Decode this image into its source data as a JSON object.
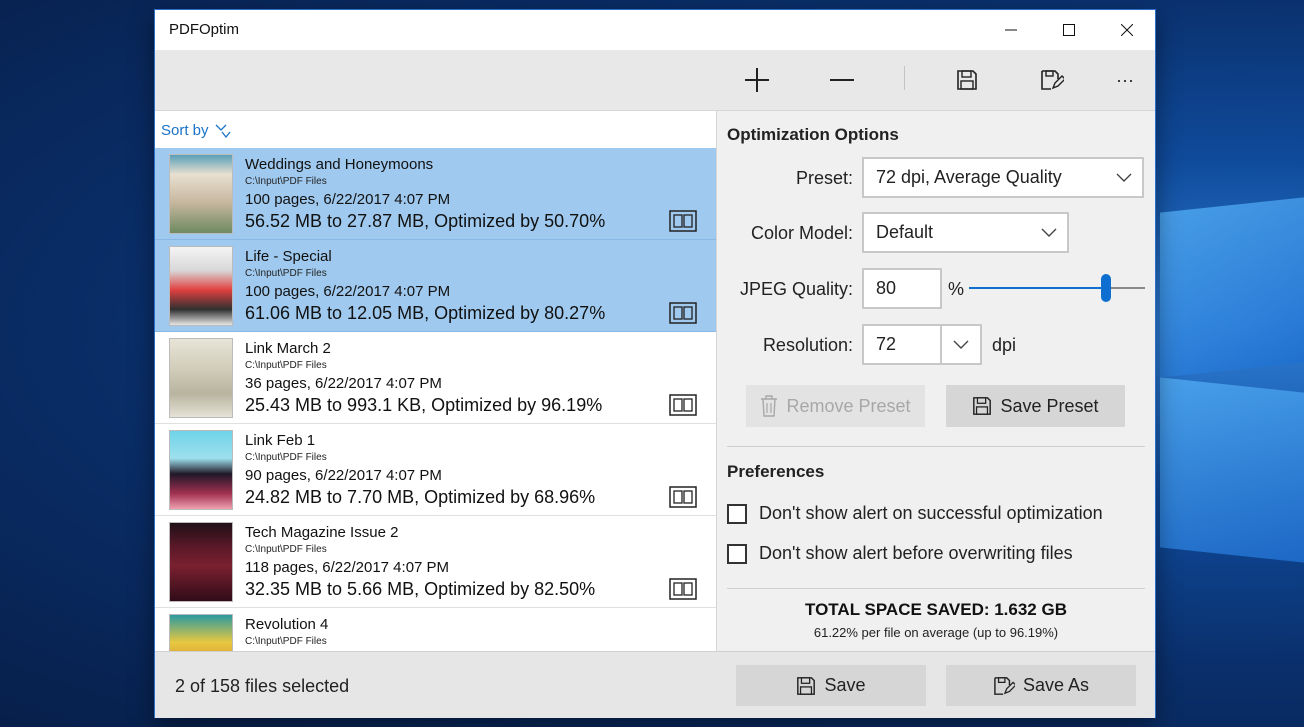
{
  "window": {
    "title": "PDFOptim"
  },
  "toolbar": {
    "add": "plus-icon",
    "remove": "minus-icon",
    "save": "save-icon",
    "save_as": "save-as-icon",
    "more": "···"
  },
  "list": {
    "sort_label": "Sort by",
    "items": [
      {
        "name": "Weddings and Honeymoons",
        "path": "C:\\Input\\PDF Files",
        "meta": "100 pages, 6/22/2017 4:07 PM",
        "result": "56.52 MB to 27.87 MB, Optimized by 50.70%",
        "selected": true
      },
      {
        "name": "Life - Special",
        "path": "C:\\Input\\PDF Files",
        "meta": "100 pages, 6/22/2017 4:07 PM",
        "result": "61.06 MB to 12.05 MB, Optimized by 80.27%",
        "selected": true
      },
      {
        "name": "Link March 2",
        "path": "C:\\Input\\PDF Files",
        "meta": "36 pages, 6/22/2017 4:07 PM",
        "result": "25.43 MB to 993.1 KB, Optimized by 96.19%",
        "selected": false
      },
      {
        "name": "Link Feb 1",
        "path": "C:\\Input\\PDF Files",
        "meta": "90 pages, 6/22/2017 4:07 PM",
        "result": "24.82 MB to 7.70 MB, Optimized by 68.96%",
        "selected": false
      },
      {
        "name": "Tech Magazine Issue 2",
        "path": "C:\\Input\\PDF Files",
        "meta": "118 pages, 6/22/2017 4:07 PM",
        "result": "32.35 MB to 5.66 MB, Optimized by 82.50%",
        "selected": false
      },
      {
        "name": "Revolution 4",
        "path": "C:\\Input\\PDF Files",
        "meta": "",
        "result": "",
        "selected": false
      }
    ]
  },
  "options": {
    "heading": "Optimization Options",
    "preset_label": "Preset:",
    "preset_value": "72 dpi, Average Quality",
    "color_label": "Color Model:",
    "color_value": "Default",
    "jpeg_label": "JPEG Quality:",
    "jpeg_value": "80",
    "jpeg_unit": "%",
    "jpeg_slider_fraction": 0.8,
    "resolution_label": "Resolution:",
    "resolution_value": "72",
    "resolution_unit": "dpi",
    "remove_preset": "Remove Preset",
    "save_preset": "Save Preset"
  },
  "preferences": {
    "heading": "Preferences",
    "opt1": "Don't show alert on successful optimization",
    "opt2": "Don't show alert before overwriting files",
    "opt1_checked": false,
    "opt2_checked": false
  },
  "summary": {
    "total": "TOTAL SPACE SAVED: 1.632 GB",
    "average": "61.22% per file on average (up to 96.19%)"
  },
  "status": {
    "selection": "2 of 158 files selected",
    "save": "Save",
    "save_as": "Save As"
  },
  "colors": {
    "accent": "#1a73c8",
    "selected_row": "#9fc9ee",
    "slider": "#0e6fd1"
  }
}
